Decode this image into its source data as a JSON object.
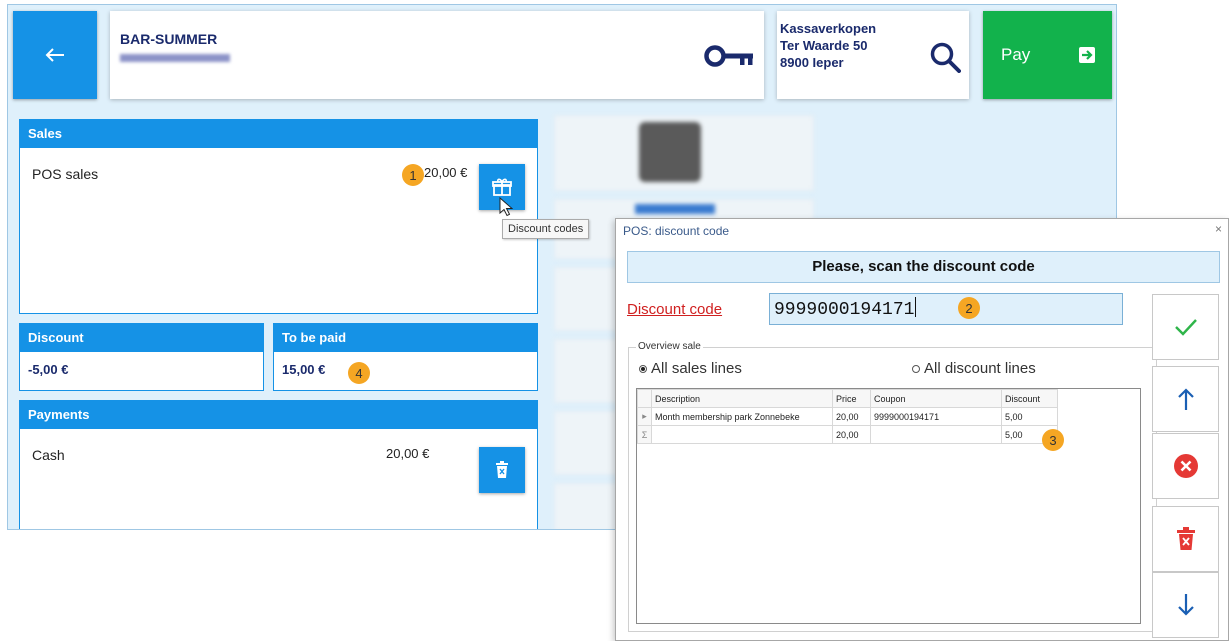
{
  "header": {
    "back_icon": "arrow-left-icon",
    "customer_name": "BAR-SUMMER",
    "key_icon": "key-icon",
    "location_lines": [
      "Kassaverkopen",
      "Ter Waarde 50",
      "8900 Ieper"
    ],
    "search_icon": "search-icon",
    "pay_label": "Pay",
    "pay_icon": "exit-arrow-icon"
  },
  "sales": {
    "title": "Sales",
    "line_label": "POS sales",
    "amount": "20,00 €",
    "badge": "1",
    "discount_button_icon": "gift-icon",
    "tooltip": "Discount codes"
  },
  "discount": {
    "title": "Discount",
    "value": "-5,00 €"
  },
  "to_be_paid": {
    "title": "To be paid",
    "value": "15,00 €",
    "badge": "4"
  },
  "payments": {
    "title": "Payments",
    "line_label": "Cash",
    "amount": "20,00 €",
    "delete_icon": "trash-icon"
  },
  "dialog": {
    "title": "POS: discount code",
    "close": "×",
    "instruction": "Please, scan the discount code",
    "code_label": "Discount code",
    "code_value": "9999000194171",
    "code_badge": "2",
    "overview_label": "Overview sale",
    "radio_all_sales": "All sales lines",
    "radio_all_discount": "All discount lines",
    "table": {
      "columns": [
        "Description",
        "Price",
        "Coupon",
        "Discount"
      ],
      "rows": [
        {
          "marker": "▸",
          "description": "Month membership park Zonnebeke",
          "price": "20,00",
          "coupon": "9999000194171",
          "discount": "5,00"
        }
      ],
      "totals": {
        "marker": "Σ",
        "price": "20,00",
        "discount": "5,00"
      },
      "totals_badge": "3"
    },
    "side_buttons": [
      "check-icon",
      "arrow-up-icon",
      "cancel-circle-icon",
      "trash-icon",
      "arrow-down-icon"
    ]
  },
  "colors": {
    "accent": "#1592e6",
    "pay": "#12b24c",
    "badge": "#f5a623",
    "danger": "#e53935",
    "confirm": "#2fb54a"
  }
}
